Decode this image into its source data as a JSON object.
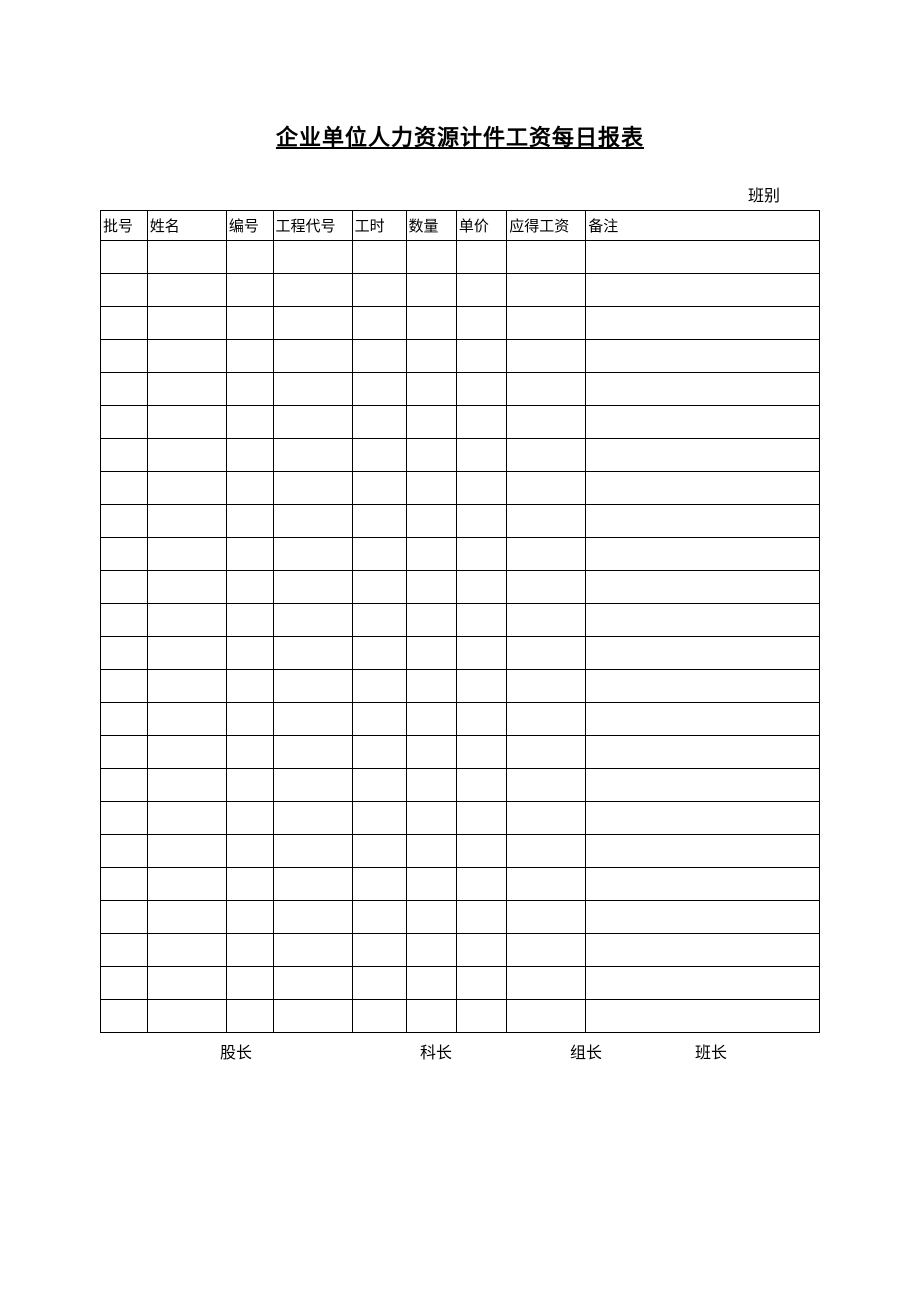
{
  "title": "企业单位人力资源计件工资每日报表",
  "topLabel": "班别",
  "headers": [
    "批号",
    "姓名",
    "编号",
    "工程代号",
    "工时",
    "数量",
    "单价",
    "应得工资",
    "备注"
  ],
  "rows": [
    [
      "",
      "",
      "",
      "",
      "",
      "",
      "",
      "",
      ""
    ],
    [
      "",
      "",
      "",
      "",
      "",
      "",
      "",
      "",
      ""
    ],
    [
      "",
      "",
      "",
      "",
      "",
      "",
      "",
      "",
      ""
    ],
    [
      "",
      "",
      "",
      "",
      "",
      "",
      "",
      "",
      ""
    ],
    [
      "",
      "",
      "",
      "",
      "",
      "",
      "",
      "",
      ""
    ],
    [
      "",
      "",
      "",
      "",
      "",
      "",
      "",
      "",
      ""
    ],
    [
      "",
      "",
      "",
      "",
      "",
      "",
      "",
      "",
      ""
    ],
    [
      "",
      "",
      "",
      "",
      "",
      "",
      "",
      "",
      ""
    ],
    [
      "",
      "",
      "",
      "",
      "",
      "",
      "",
      "",
      ""
    ],
    [
      "",
      "",
      "",
      "",
      "",
      "",
      "",
      "",
      ""
    ],
    [
      "",
      "",
      "",
      "",
      "",
      "",
      "",
      "",
      ""
    ],
    [
      "",
      "",
      "",
      "",
      "",
      "",
      "",
      "",
      ""
    ],
    [
      "",
      "",
      "",
      "",
      "",
      "",
      "",
      "",
      ""
    ],
    [
      "",
      "",
      "",
      "",
      "",
      "",
      "",
      "",
      ""
    ],
    [
      "",
      "",
      "",
      "",
      "",
      "",
      "",
      "",
      ""
    ],
    [
      "",
      "",
      "",
      "",
      "",
      "",
      "",
      "",
      ""
    ],
    [
      "",
      "",
      "",
      "",
      "",
      "",
      "",
      "",
      ""
    ],
    [
      "",
      "",
      "",
      "",
      "",
      "",
      "",
      "",
      ""
    ],
    [
      "",
      "",
      "",
      "",
      "",
      "",
      "",
      "",
      ""
    ],
    [
      "",
      "",
      "",
      "",
      "",
      "",
      "",
      "",
      ""
    ],
    [
      "",
      "",
      "",
      "",
      "",
      "",
      "",
      "",
      ""
    ],
    [
      "",
      "",
      "",
      "",
      "",
      "",
      "",
      "",
      ""
    ],
    [
      "",
      "",
      "",
      "",
      "",
      "",
      "",
      "",
      ""
    ],
    [
      "",
      "",
      "",
      "",
      "",
      "",
      "",
      "",
      ""
    ]
  ],
  "footer": [
    "股长",
    "科长",
    "组长",
    "班长"
  ]
}
